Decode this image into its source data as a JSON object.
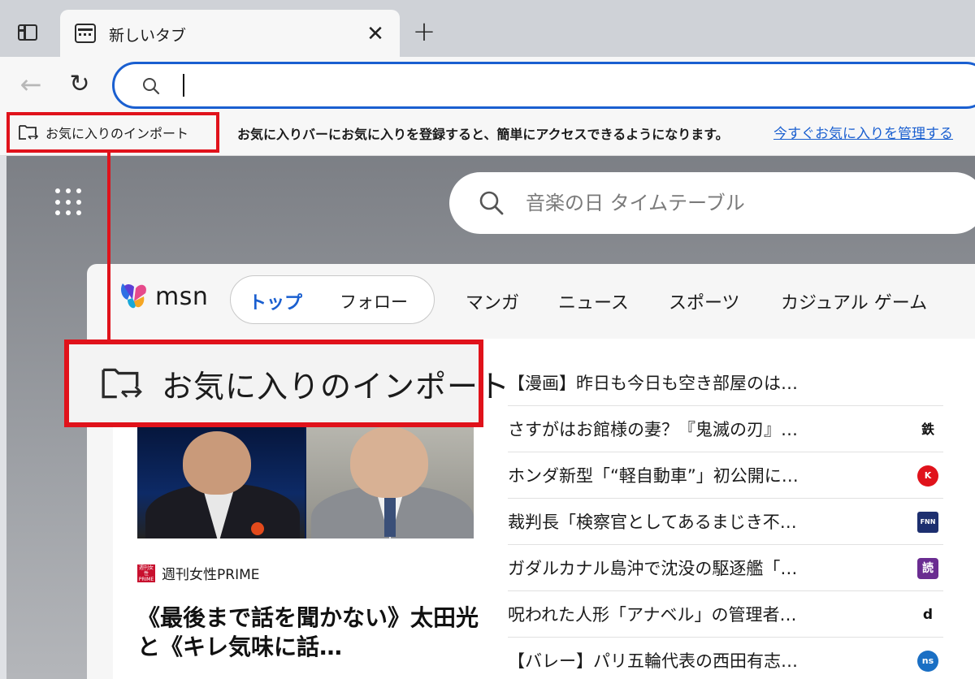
{
  "browser": {
    "tab": {
      "title": "新しいタブ",
      "close_glyph": "✕"
    },
    "new_tab_glyph": "+",
    "back_glyph": "←",
    "refresh_glyph": "↻",
    "address_bar": {
      "value": "",
      "placeholder": ""
    }
  },
  "favorites_bar": {
    "import_label": "お気に入りのインポート",
    "message": "お気に入りバーにお気に入りを登録すると、簡単にアクセスできるようになります。",
    "manage_link": "今すぐお気に入りを管理する"
  },
  "new_tab_page": {
    "search_placeholder": "音楽の日 タイムテーブル"
  },
  "msn": {
    "wordmark": "msn",
    "tabs": {
      "top": "トップ",
      "follow": "フォロー"
    },
    "nav": [
      "マンガ",
      "ニュース",
      "スポーツ",
      "カジュアル ゲーム"
    ],
    "hero": {
      "source": "週刊女性PRIME",
      "source_logo_text": "週刊女性PRIME",
      "headline": "《最後まで話を聞かない》太田光と《キレ気味に話…"
    },
    "news": [
      {
        "title": "【漫画】昨日も今日も空き部屋のは…",
        "src": "",
        "src_color": "#ffffff"
      },
      {
        "title": "さすがはお館様の妻？『鬼滅の刃』…",
        "src": "鉄",
        "src_color": "#ffffff"
      },
      {
        "title": "ホンダ新型「“軽自動車”」初公開に…",
        "src": "K",
        "src_color": "#e0121b"
      },
      {
        "title": "裁判長「検察官としてあるまじき不…",
        "src": "FNN",
        "src_color": "#1d2f6f"
      },
      {
        "title": "ガダルカナル島沖で沈没の駆逐艦「…",
        "src": "読",
        "src_color": "#6a2c91"
      },
      {
        "title": "呪われた人形「アナベル」の管理者…",
        "src": "d",
        "src_color": "#ffffff"
      },
      {
        "title": "【バレー】パリ五輪代表の西田有志…",
        "src": "ns",
        "src_color": "#1a6fc4"
      }
    ]
  },
  "callout": {
    "label": "お気に入りのインポート"
  },
  "colors": {
    "highlight": "#e0121b",
    "accent": "#1a5fd0"
  }
}
